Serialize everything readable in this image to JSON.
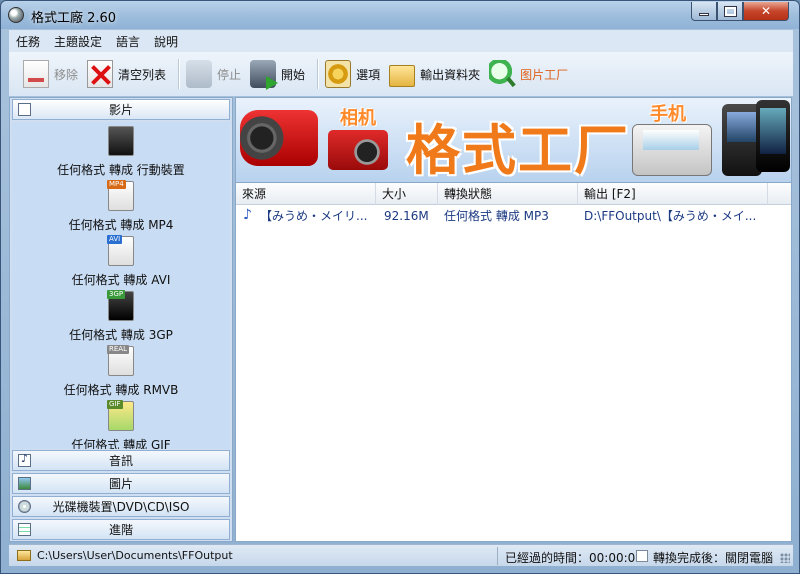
{
  "window": {
    "title": "格式工廠 2.60"
  },
  "menu": [
    "任務",
    "主題設定",
    "語言",
    "說明"
  ],
  "toolbar": {
    "remove": "移除",
    "clear_list": "清空列表",
    "stop": "停止",
    "start": "開始",
    "options": "選項",
    "output_folder": "輸出資料夾",
    "picture_factory": "图片工厂"
  },
  "sidebar": {
    "categories": {
      "video": "影片",
      "audio": "音訊",
      "picture": "圖片",
      "rom": "光碟機裝置\\DVD\\CD\\ISO",
      "advanced": "進階"
    },
    "video_items": [
      {
        "label": "任何格式 轉成 行動裝置",
        "tag": ""
      },
      {
        "label": "任何格式 轉成 MP4",
        "tag": "MP4"
      },
      {
        "label": "任何格式 轉成 AVI",
        "tag": "AVI"
      },
      {
        "label": "任何格式 轉成 3GP",
        "tag": "3GP"
      },
      {
        "label": "任何格式 轉成 RMVB",
        "tag": "REAL"
      },
      {
        "label": "任何格式 轉成 GIF",
        "tag": "GIF"
      }
    ]
  },
  "banner": {
    "title": "格式工厂",
    "camera_label": "相机",
    "phone_label": "手机"
  },
  "tasks": {
    "columns": [
      "來源",
      "大小",
      "轉換狀態",
      "輸出 [F2]"
    ],
    "rows": [
      {
        "source": "【みうめ・メイリ...",
        "size": "92.16M",
        "status": "任何格式 轉成 MP3",
        "output": "D:\\FFOutput\\【みうめ・メイ..."
      }
    ]
  },
  "status": {
    "path": "C:\\Users\\User\\Documents\\FFOutput",
    "elapsed": "已經過的時間：00:00:00",
    "after_convert": "轉換完成後：關閉電腦"
  }
}
